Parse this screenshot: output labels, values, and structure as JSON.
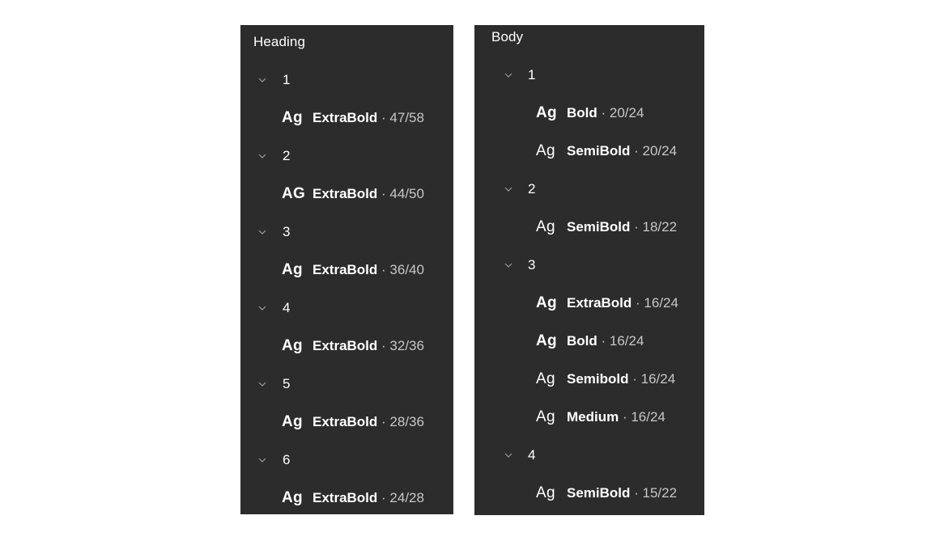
{
  "heading_panel": {
    "title": "Heading",
    "groups": [
      {
        "label": "1",
        "styles": [
          {
            "preview": "Ag",
            "weight": "ExtraBold",
            "metrics": " · 47/58"
          }
        ]
      },
      {
        "label": "2",
        "styles": [
          {
            "preview": "AG",
            "weight": "ExtraBold",
            "metrics": " · 44/50"
          }
        ]
      },
      {
        "label": "3",
        "styles": [
          {
            "preview": "Ag",
            "weight": "ExtraBold",
            "metrics": " · 36/40"
          }
        ]
      },
      {
        "label": "4",
        "styles": [
          {
            "preview": "Ag",
            "weight": "ExtraBold",
            "metrics": " · 32/36"
          }
        ]
      },
      {
        "label": "5",
        "styles": [
          {
            "preview": "Ag",
            "weight": "ExtraBold",
            "metrics": " · 28/36"
          }
        ]
      },
      {
        "label": "6",
        "styles": [
          {
            "preview": "Ag",
            "weight": "ExtraBold",
            "metrics": " · 24/28"
          }
        ]
      }
    ]
  },
  "body_panel": {
    "title": "Body",
    "groups": [
      {
        "label": "1",
        "styles": [
          {
            "preview": "Ag",
            "weight": "Bold",
            "metrics": " · 20/24"
          },
          {
            "preview": "Ag",
            "weight": "SemiBold",
            "metrics": " · 20/24"
          }
        ]
      },
      {
        "label": "2",
        "styles": [
          {
            "preview": "Ag",
            "weight": "SemiBold",
            "metrics": " · 18/22"
          }
        ]
      },
      {
        "label": "3",
        "styles": [
          {
            "preview": "Ag",
            "weight": "ExtraBold",
            "metrics": " · 16/24"
          },
          {
            "preview": "Ag",
            "weight": "Bold",
            "metrics": " · 16/24"
          },
          {
            "preview": "Ag",
            "weight": "Semibold",
            "metrics": " · 16/24"
          },
          {
            "preview": "Ag",
            "weight": "Medium",
            "metrics": " · 16/24"
          }
        ]
      },
      {
        "label": "4",
        "styles": [
          {
            "preview": "Ag",
            "weight": "SemiBold",
            "metrics": " · 15/22"
          }
        ]
      }
    ]
  },
  "colors": {
    "panel_bg": "#2c2c2c",
    "text_primary": "#ffffff",
    "text_secondary": "#c7c7c7",
    "chevron": "#9a9a9a"
  },
  "icons": {
    "group_toggle": "chevron-down-icon"
  }
}
